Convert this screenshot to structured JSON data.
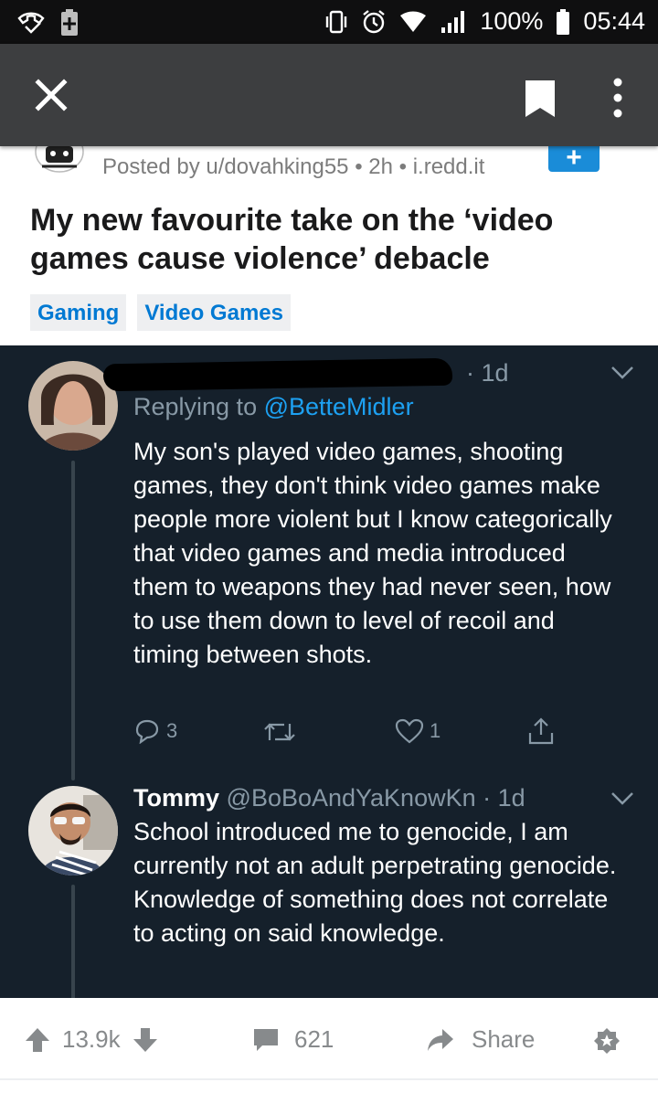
{
  "status_bar": {
    "battery_percent": "100%",
    "time": "05:44"
  },
  "post": {
    "meta": "Posted by u/dovahking55 • 2h • i.redd.it",
    "title": "My new favourite take on the ‘video games cause violence’ debacle",
    "tags": [
      "Gaming",
      "Video Games"
    ]
  },
  "tweets": [
    {
      "header_partial": "· 1d",
      "reply_prefix": "Replying to ",
      "reply_handle": "@BetteMidler",
      "text": "My son's played video games, shooting games, they don't think video games make people more violent but I know categorically that video games and media introduced them to weapons they had never seen, how to use them down to level of recoil and timing between shots.",
      "reply_count": "3",
      "like_count": "1"
    },
    {
      "name": "Tommy",
      "handle_time": "@BoBoAndYaKnowKn · 1d",
      "text": "School introduced me to genocide, I am currently not an adult perpetrating genocide.  Knowledge of something does not correlate to acting on said knowledge."
    }
  ],
  "bottom_bar": {
    "score": "13.9k",
    "comments": "621",
    "share_label": "Share"
  },
  "colors": {
    "status_bar": "#0f0f10",
    "app_bar": "#3d3e40",
    "tweet_bg": "#15202b",
    "link_blue": "#1da1f2",
    "reddit_blue": "#0079d3"
  }
}
